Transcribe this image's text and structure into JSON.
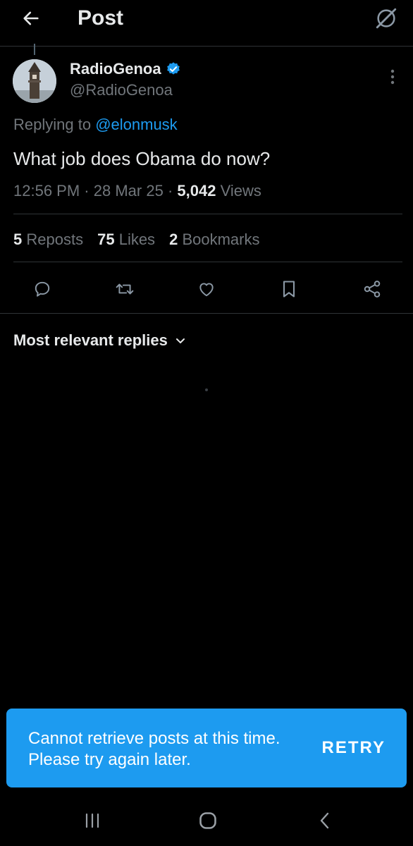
{
  "header": {
    "title": "Post",
    "back_icon": "arrow-left-icon",
    "grok_icon": "grok-icon"
  },
  "post": {
    "display_name": "RadioGenoa",
    "handle": "@RadioGenoa",
    "verified": true,
    "replying_prefix": "Replying to ",
    "replying_to": "@elonmusk",
    "text": "What job does Obama do now?",
    "time": "12:56 PM",
    "date": "28 Mar 25",
    "views_count": "5,042",
    "views_label": "Views",
    "meta_separator": "·"
  },
  "stats": {
    "reposts_count": "5",
    "reposts_label": "Reposts",
    "likes_count": "75",
    "likes_label": "Likes",
    "bookmarks_count": "2",
    "bookmarks_label": "Bookmarks"
  },
  "actions": [
    "reply-icon",
    "repost-icon",
    "like-icon",
    "bookmark-icon",
    "share-icon"
  ],
  "replies": {
    "sort_label": "Most relevant replies"
  },
  "toast": {
    "message": "Cannot retrieve posts at this time. Please try again later.",
    "retry_label": "RETRY"
  },
  "colors": {
    "background": "#000000",
    "text": "#e7e9ea",
    "muted": "#71767b",
    "accent": "#1d9bf0",
    "divider": "#2f3336"
  }
}
